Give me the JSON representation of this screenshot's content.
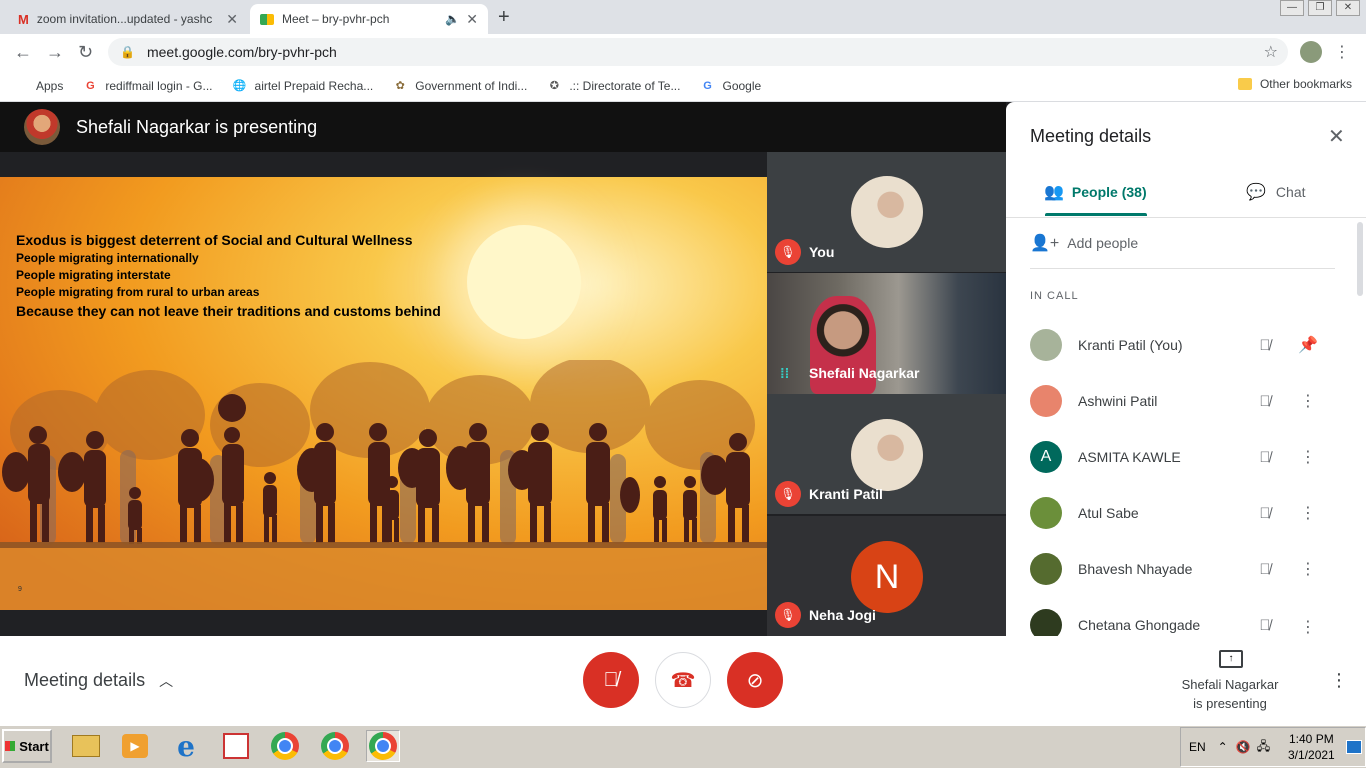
{
  "browser": {
    "tabs": [
      {
        "title": "zoom invitation...updated - yashc",
        "active": false,
        "icon": "gmail-icon"
      },
      {
        "title": "Meet – bry-pvhr-pch",
        "active": true,
        "icon": "meet-icon"
      }
    ],
    "url": "meet.google.com/bry-pvhr-pch",
    "bookmarks": [
      {
        "label": "Apps",
        "icon": "apps-grid-icon"
      },
      {
        "label": "rediffmail login - G...",
        "icon": "google-icon"
      },
      {
        "label": "airtel Prepaid Recha...",
        "icon": "globe-icon"
      },
      {
        "label": "Government of Indi...",
        "icon": "emblem-icon"
      },
      {
        "label": ".:: Directorate of Te...",
        "icon": "emblem-icon"
      },
      {
        "label": "Google",
        "icon": "google-icon"
      }
    ],
    "other_bookmarks": "Other bookmarks"
  },
  "meet": {
    "presenting_title": "Shefali Nagarkar is presenting",
    "slide": {
      "lines": [
        "Exodus is biggest deterrent of Social and Cultural Wellness",
        "People migrating internationally",
        "People migrating interstate",
        "People migrating from rural to urban areas",
        "Because they can not leave their traditions and customs behind"
      ],
      "page": "9"
    },
    "tiles": [
      {
        "name": "You",
        "muted": true
      },
      {
        "name": "Shefali Nagarkar",
        "muted": false,
        "speaking": true
      },
      {
        "name": "Kranti Patil",
        "muted": true
      },
      {
        "name": "Neha Jogi",
        "muted": true,
        "initial": "N"
      }
    ]
  },
  "panel": {
    "title": "Meeting details",
    "tab_people": "People (38)",
    "tab_chat": "Chat",
    "add_people": "Add people",
    "section": "IN CALL",
    "participants": [
      {
        "name": "Kranti Patil (You)",
        "action": "pin-icon",
        "avatar_color": "#a7b39a"
      },
      {
        "name": "Ashwini Patil",
        "action": "more-icon",
        "avatar_color": "#e8846c"
      },
      {
        "name": "ASMITA KAWLE",
        "action": "more-icon",
        "initial": "A",
        "avatar_color": "#00695c"
      },
      {
        "name": "Atul Sabe",
        "action": "more-icon",
        "avatar_color": "#6b8f3a"
      },
      {
        "name": "Bhavesh Nhayade",
        "action": "more-icon",
        "avatar_color": "#556b2f"
      },
      {
        "name": "Chetana Ghongade",
        "action": "more-icon",
        "avatar_color": "#2e3b1f"
      }
    ]
  },
  "bottom": {
    "meeting_details": "Meeting details",
    "presenting_line1": "Shefali Nagarkar",
    "presenting_line2": "is presenting"
  },
  "taskbar": {
    "start": "Start",
    "lang": "EN",
    "time": "1:40 PM",
    "date": "3/1/2021"
  }
}
